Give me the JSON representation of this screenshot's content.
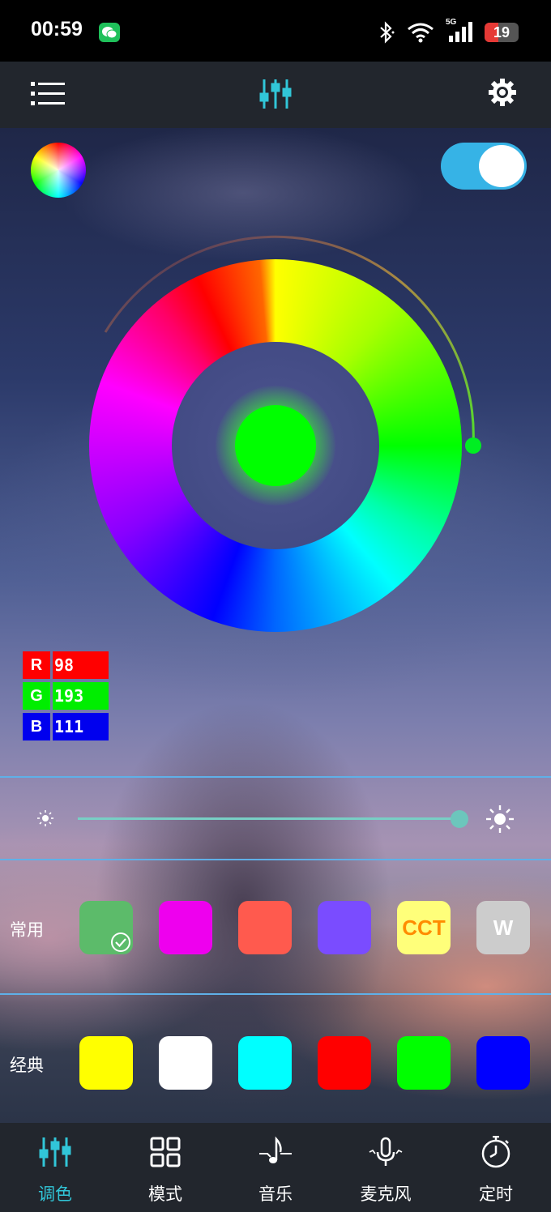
{
  "status_bar": {
    "time": "00:59",
    "network": "5G",
    "battery": "19",
    "battery_color": "#e53935"
  },
  "app_bar": {
    "left_icon": "menu-list-icon",
    "center_icon": "equalizer-icon",
    "right_icon": "gear-icon"
  },
  "power": {
    "on": true,
    "color": "#36b3e6"
  },
  "selected_color": "#00ff00",
  "rgb": {
    "r_label": "R",
    "r_value": "98",
    "r_color": "#ff0000",
    "g_label": "G",
    "g_value": "193",
    "g_color": "#00ff00",
    "b_label": "B",
    "b_value": "111",
    "b_color": "#0000ff"
  },
  "brightness": {
    "level": 0.99,
    "accent": "#6cc6bc"
  },
  "common": {
    "label": "常用",
    "swatches": [
      {
        "color": "#5cbb6a",
        "text": "",
        "selected": true
      },
      {
        "color": "#ee00ee",
        "text": ""
      },
      {
        "color": "#ff5a4e",
        "text": ""
      },
      {
        "color": "#7a4cff",
        "text": ""
      },
      {
        "color": "#ffff7a",
        "text": "CCT",
        "text_color": "#ff8c00"
      },
      {
        "color": "#cccccc",
        "text": "W",
        "text_color": "#ffffff"
      }
    ]
  },
  "classic": {
    "label": "经典",
    "swatches": [
      {
        "color": "#ffff00"
      },
      {
        "color": "#ffffff"
      },
      {
        "color": "#00ffff"
      },
      {
        "color": "#ff0000"
      },
      {
        "color": "#00ff00"
      },
      {
        "color": "#0000ff"
      }
    ]
  },
  "bottom_nav": {
    "active_color": "#31c6d8",
    "items": [
      {
        "label": "调色",
        "icon": "color-adjust-icon",
        "active": true
      },
      {
        "label": "模式",
        "icon": "mode-grid-icon"
      },
      {
        "label": "音乐",
        "icon": "music-note-icon"
      },
      {
        "label": "麦克风",
        "icon": "microphone-icon"
      },
      {
        "label": "定时",
        "icon": "timer-icon"
      }
    ]
  }
}
